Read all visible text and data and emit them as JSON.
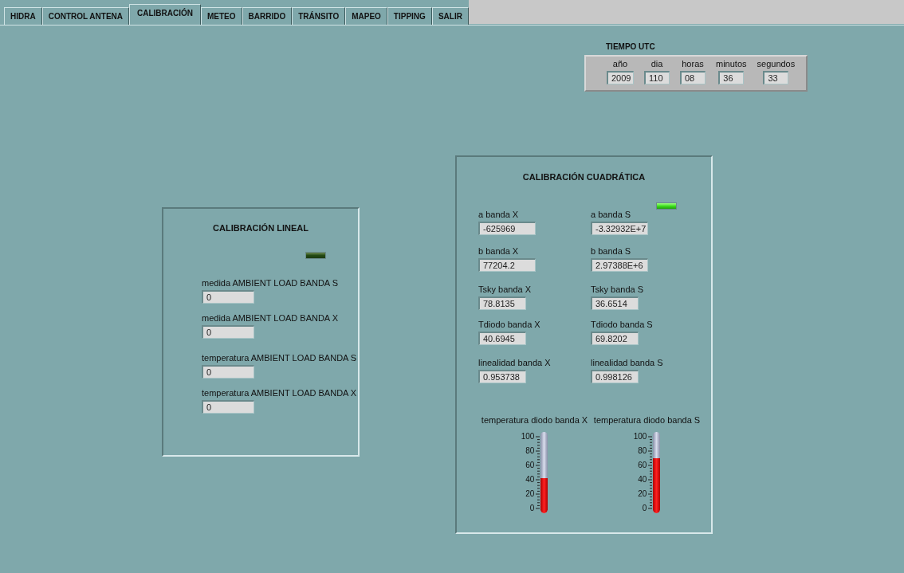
{
  "tabs": [
    {
      "label": "HIDRA",
      "selected": false
    },
    {
      "label": "CONTROL ANTENA",
      "selected": false
    },
    {
      "label": "CALIBRACIÓN",
      "selected": true
    },
    {
      "label": "METEO",
      "selected": false
    },
    {
      "label": "BARRIDO",
      "selected": false
    },
    {
      "label": "TRÁNSITO",
      "selected": false
    },
    {
      "label": "MAPEO",
      "selected": false
    },
    {
      "label": "TIPPING",
      "selected": false
    },
    {
      "label": "SALIR",
      "selected": false
    }
  ],
  "utc": {
    "title": "TIEMPO UTC",
    "fields": [
      {
        "label": "año",
        "value": "2009"
      },
      {
        "label": "dia",
        "value": "110"
      },
      {
        "label": "horas",
        "value": "08"
      },
      {
        "label": "minutos",
        "value": "36"
      },
      {
        "label": "segundos",
        "value": "33"
      }
    ]
  },
  "linear": {
    "title": "CALIBRACIÓN LINEAL",
    "led": {
      "on": false
    },
    "fields": [
      {
        "label": "medida AMBIENT LOAD BANDA S",
        "value": "0"
      },
      {
        "label": "medida AMBIENT LOAD BANDA X",
        "value": "0"
      },
      {
        "label": "temperatura AMBIENT LOAD BANDA S",
        "value": "0"
      },
      {
        "label": "temperatura AMBIENT LOAD BANDA X",
        "value": "0"
      }
    ]
  },
  "quadratic": {
    "title": "CALIBRACIÓN CUADRÁTICA",
    "led": {
      "on": true
    },
    "fields": [
      {
        "label": "a banda X",
        "value": "-625969"
      },
      {
        "label": "a banda S",
        "value": "-3.32932E+7"
      },
      {
        "label": "b banda X",
        "value": "77204.2"
      },
      {
        "label": "b banda S",
        "value": "2.97388E+6"
      },
      {
        "label": "Tsky banda X",
        "value": "78.8135"
      },
      {
        "label": "Tsky banda S",
        "value": "36.6514"
      },
      {
        "label": "Tdiodo banda X",
        "value": "40.6945"
      },
      {
        "label": "Tdiodo banda S",
        "value": "69.8202"
      },
      {
        "label": "linealidad banda X",
        "value": "0.953738"
      },
      {
        "label": "linealidad banda S",
        "value": "0.998126"
      }
    ],
    "thermometers": [
      {
        "label": "temperatura diodo banda X",
        "level": 0.42,
        "ticks": [
          "100",
          "80",
          "60",
          "40",
          "20",
          "0"
        ]
      },
      {
        "label": "temperatura diodo banda S",
        "level": 0.7,
        "ticks": [
          "100",
          "80",
          "60",
          "40",
          "20",
          "0"
        ]
      }
    ]
  }
}
